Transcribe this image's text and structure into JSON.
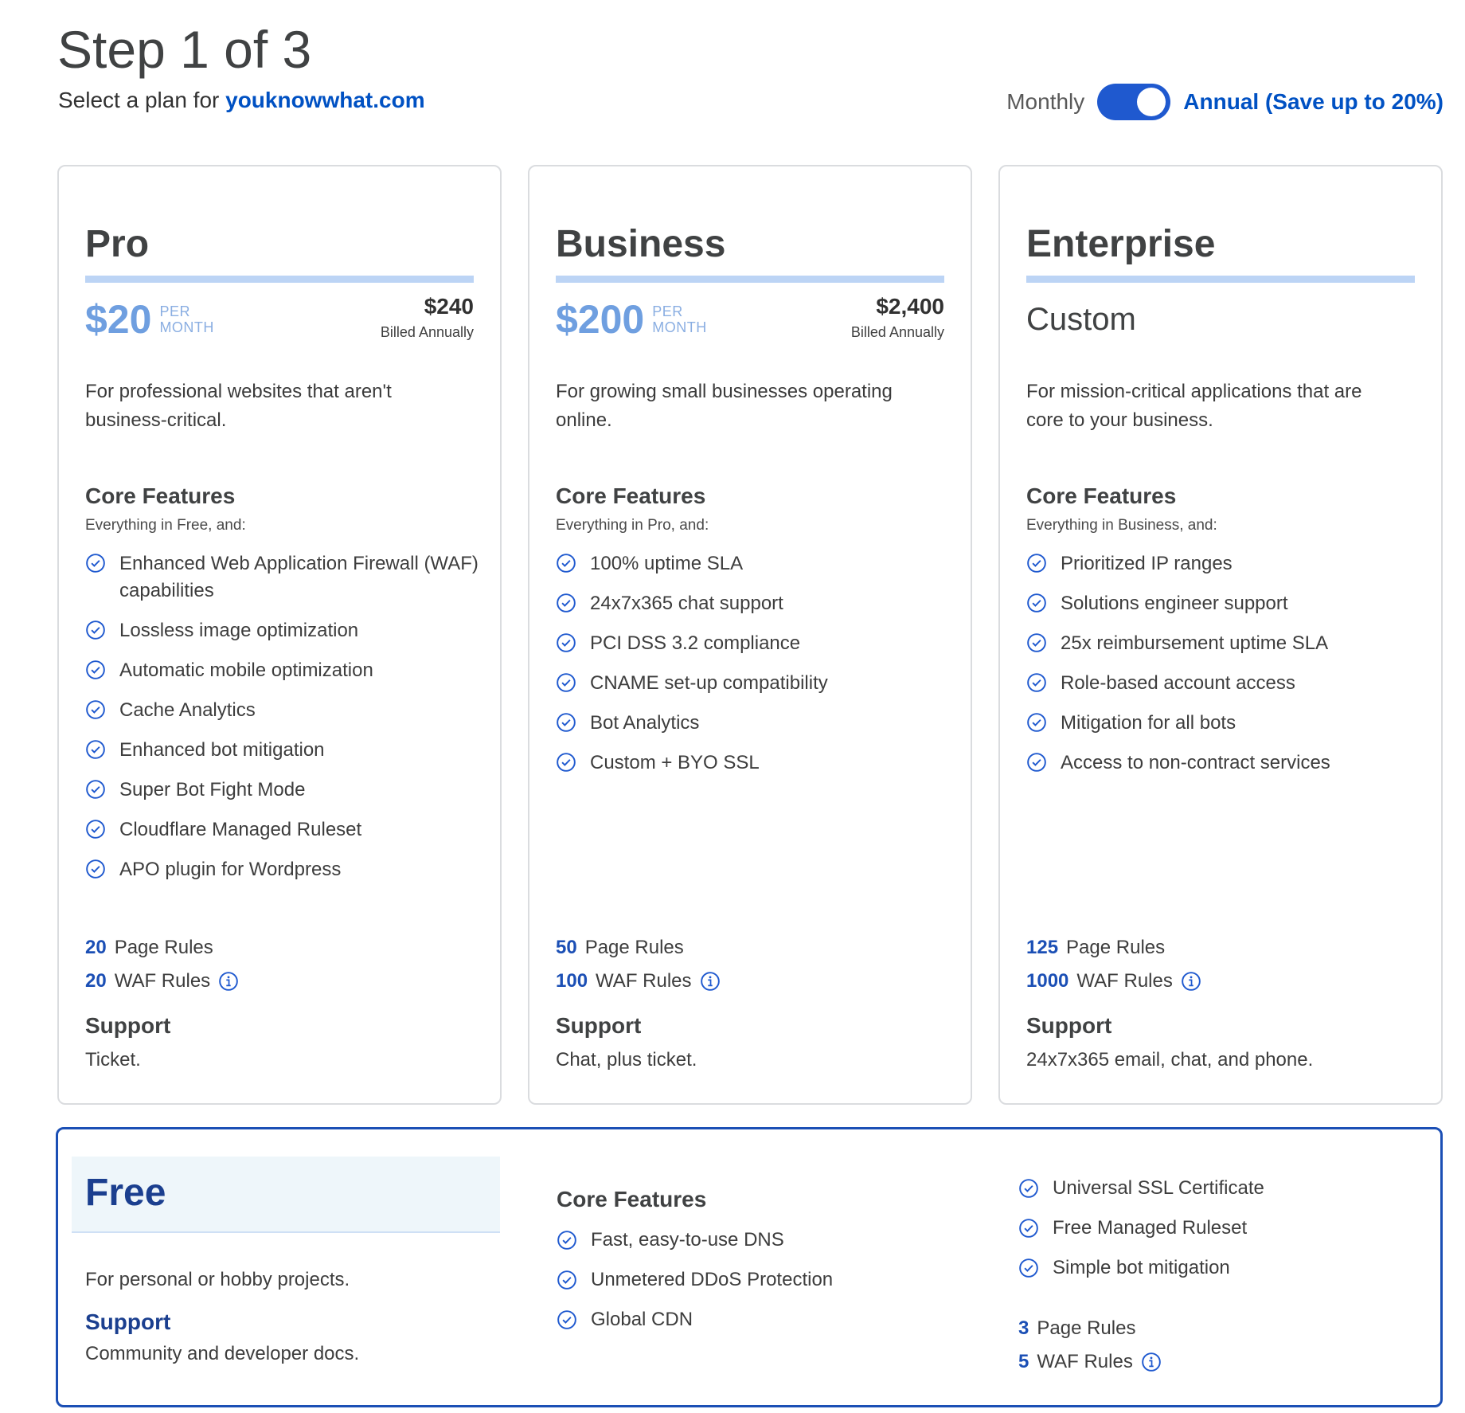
{
  "header": {
    "step": "Step 1 of 3",
    "subtitle_prefix": "Select a plan for ",
    "domain": "youknowwhat.com"
  },
  "billing": {
    "monthly_label": "Monthly",
    "annual_label": "Annual (Save up to 20%)",
    "toggle_state": "annual"
  },
  "plans": [
    {
      "name": "Pro",
      "price": "$20",
      "per": "PER",
      "per_unit": "MONTH",
      "annual_total": "$240",
      "billed": "Billed Annually",
      "description": "For professional websites that aren't business-critical.",
      "core_title": "Core Features",
      "core_sub": "Everything in Free, and:",
      "features": [
        "Enhanced Web Application Firewall (WAF) capabilities",
        "Lossless image optimization",
        "Automatic mobile optimization",
        "Cache Analytics",
        "Enhanced bot mitigation",
        "Super Bot Fight Mode",
        "Cloudflare Managed Ruleset",
        "APO plugin for Wordpress"
      ],
      "page_rules_count": "20",
      "page_rules_label": "Page Rules",
      "waf_rules_count": "20",
      "waf_rules_label": "WAF Rules",
      "support_title": "Support",
      "support_text": "Ticket."
    },
    {
      "name": "Business",
      "price": "$200",
      "per": "PER",
      "per_unit": "MONTH",
      "annual_total": "$2,400",
      "billed": "Billed Annually",
      "description": "For growing small businesses operating online.",
      "core_title": "Core Features",
      "core_sub": "Everything in Pro, and:",
      "features": [
        "100% uptime SLA",
        "24x7x365 chat support",
        "PCI DSS 3.2 compliance",
        "CNAME set-up compatibility",
        "Bot Analytics",
        "Custom + BYO SSL"
      ],
      "page_rules_count": "50",
      "page_rules_label": "Page Rules",
      "waf_rules_count": "100",
      "waf_rules_label": "WAF Rules",
      "support_title": "Support",
      "support_text": "Chat, plus ticket."
    },
    {
      "name": "Enterprise",
      "custom_price": "Custom",
      "description": "For mission-critical applications that are core to your business.",
      "core_title": "Core Features",
      "core_sub": "Everything in Business, and:",
      "features": [
        "Prioritized IP ranges",
        "Solutions engineer support",
        "25x reimbursement uptime SLA",
        "Role-based account access",
        "Mitigation for all bots",
        "Access to non-contract services"
      ],
      "page_rules_count": "125",
      "page_rules_label": "Page Rules",
      "waf_rules_count": "1000",
      "waf_rules_label": "WAF Rules",
      "support_title": "Support",
      "support_text": "24x7x365 email, chat, and phone."
    }
  ],
  "free": {
    "name": "Free",
    "description": "For personal or hobby projects.",
    "support_title": "Support",
    "support_text": "Community and developer docs.",
    "core_title": "Core Features",
    "features_left": [
      "Fast, easy-to-use DNS",
      "Unmetered DDoS Protection",
      "Global CDN"
    ],
    "features_right": [
      "Universal SSL Certificate",
      "Free Managed Ruleset",
      "Simple bot mitigation"
    ],
    "page_rules_count": "3",
    "page_rules_label": "Page Rules",
    "waf_rules_count": "5",
    "waf_rules_label": "WAF Rules"
  },
  "icons": {
    "feature_check": "check-circle-icon",
    "rules_info": "info-circle-icon"
  },
  "colors": {
    "accent": "#0051c3",
    "toggle": "#1f59cf",
    "price": "#6f9fe0",
    "rule_bar": "#bcd4f5",
    "free_border": "#1b4fb5"
  }
}
